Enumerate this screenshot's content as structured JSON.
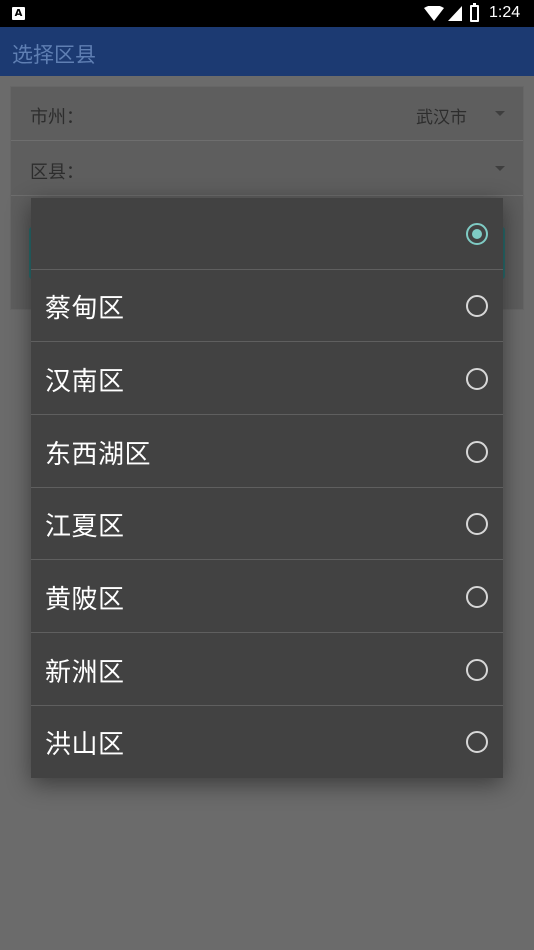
{
  "status_bar": {
    "time": "1:24",
    "notification_icon": "A"
  },
  "app_bar": {
    "title": "选择区县"
  },
  "form": {
    "city_label": "市州：",
    "city_value": "武汉市",
    "county_label": "区县：",
    "county_value": ""
  },
  "dialog": {
    "options": [
      {
        "label": "",
        "checked": true
      },
      {
        "label": "蔡甸区",
        "checked": false
      },
      {
        "label": "汉南区",
        "checked": false
      },
      {
        "label": "东西湖区",
        "checked": false
      },
      {
        "label": "江夏区",
        "checked": false
      },
      {
        "label": "黄陂区",
        "checked": false
      },
      {
        "label": "新洲区",
        "checked": false
      },
      {
        "label": "洪山区",
        "checked": false
      }
    ]
  },
  "colors": {
    "app_bar": "#1c3a72",
    "accent": "#7fcbc4",
    "dialog_bg": "#424242",
    "scrim_bg": "#6b6b6b"
  }
}
